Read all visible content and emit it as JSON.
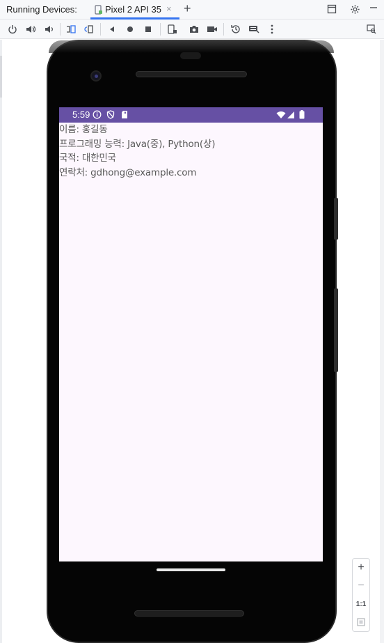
{
  "header": {
    "title": "Running Devices:",
    "tab_label": "Pixel 2 API 35",
    "tab_close": "×",
    "add_tab": "+"
  },
  "toolbar": {
    "buttons": [
      "power-icon",
      "volume-up-icon",
      "volume-down-icon",
      "rotate-left-icon",
      "rotate-right-icon",
      "back-icon",
      "home-icon",
      "overview-icon",
      "device-mirror-icon",
      "screenshot-icon",
      "screen-record-icon",
      "snapshot-icon",
      "keyboard-icon",
      "more-icon",
      "device-manager-icon"
    ]
  },
  "device": {
    "name": "Pixel 2 API 35",
    "status_time": "5:59",
    "status_bar_color": "#6650a4",
    "screen_background": "#fdf7fe"
  },
  "app": {
    "name_line": "이름: 홍길동",
    "skills_line": "프로그래밍 능력: Java(중), Python(상)",
    "nationality_line": "국적: 대한민국",
    "contact_line": "연락처: gdhong@example.com"
  },
  "zoom": {
    "zoom_in": "+",
    "zoom_out": "−",
    "actual_size": "1:1"
  },
  "colors": {
    "accent": "#3574f0",
    "text": "#5a5a5a"
  }
}
